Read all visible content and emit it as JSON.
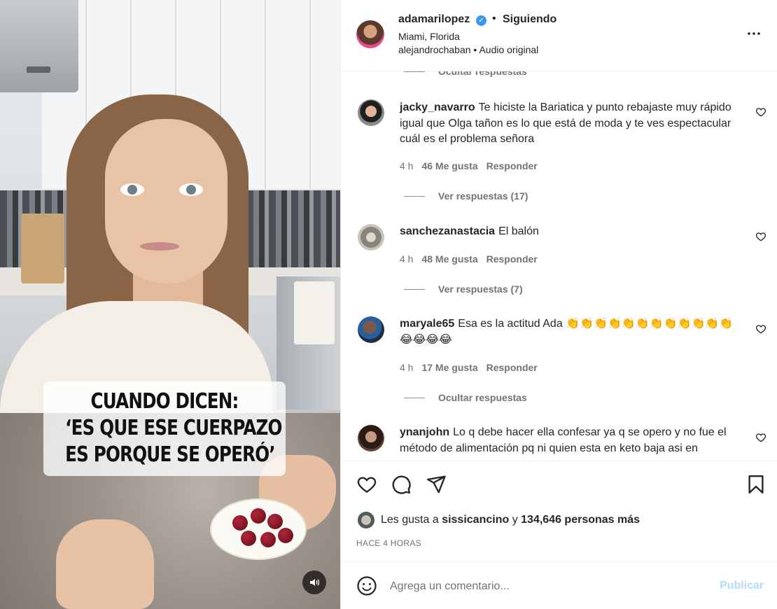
{
  "post": {
    "username": "adamarilopez",
    "follow_status": "Siguiendo",
    "location": "Miami, Florida",
    "audio": "alejandrochaban • Audio original",
    "video_caption_lines": [
      "CUANDO DICEN:",
      "‘ES QUE ESE CUERPAZO",
      "ES PORQUE SE OPERÓ’"
    ]
  },
  "comments": {
    "thread_top_toggle": "Ocultar respuestas",
    "items": [
      {
        "user": "jacky_navarro",
        "text": "Te hiciste la Bariatica y punto rebajaste muy rápido igual que Olga tañon es lo que está de moda y te ves espectacular cuál es el problema señora",
        "time": "4 h",
        "likes": "46 Me gusta",
        "reply": "Responder",
        "replies_toggle": "Ver respuestas (17)"
      },
      {
        "user": "sanchezanastacia",
        "text": "El balón",
        "time": "4 h",
        "likes": "48 Me gusta",
        "reply": "Responder",
        "replies_toggle": "Ver respuestas (7)"
      },
      {
        "user": "maryale65",
        "text": "Esa es la actitud Ada 👏👏👏👏👏👏👏👏👏👏👏👏😂😂😂😂",
        "time": "4 h",
        "likes": "17 Me gusta",
        "reply": "Responder",
        "replies_toggle": "Ocultar respuestas"
      },
      {
        "user": "ynanjohn",
        "text": "Lo q debe hacer ella confesar ya q se opero y no fue el método de alimentación pq ni quien esta en keto baja asi en"
      }
    ]
  },
  "likes": {
    "prefix": "Les gusta a",
    "user": "sissicancino",
    "connector": "y",
    "others": "134,646 personas más"
  },
  "time_ago": "HACE 4 HORAS",
  "composer": {
    "placeholder": "Agrega un comentario...",
    "publish_label": "Publicar"
  },
  "colors": {
    "verified": "#3897f0",
    "publish_disabled": "#b3dbff",
    "meta_text": "#737373"
  }
}
